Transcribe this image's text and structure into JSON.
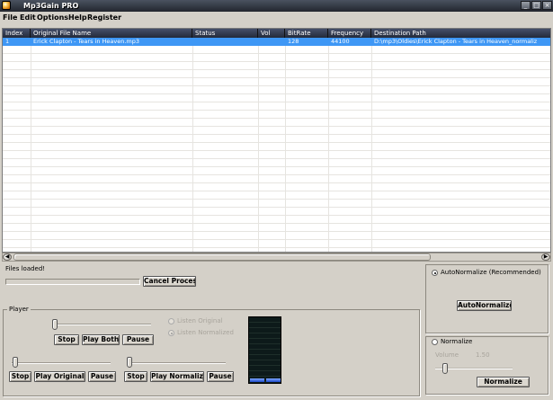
{
  "window": {
    "title": "Mp3Gain PRO"
  },
  "menu": [
    "File",
    "Edit",
    "Options",
    "Help",
    "Register"
  ],
  "table": {
    "columns": [
      "Index",
      "Original File Name",
      "Status",
      "Vol",
      "BitRate",
      "Frequency",
      "Destination Path"
    ],
    "rows": [
      [
        "1",
        "Erick Clapton - Tears in Heaven.mp3",
        "",
        "",
        "128",
        "44100",
        "D:\\mp3\\Oldies\\Erick Clapton - Tears in Heaven_normaliz"
      ]
    ]
  },
  "status": {
    "message": "Files loaded!",
    "progress": 0
  },
  "buttons": {
    "cancel": "Cancel Process",
    "auto_normalize": "AutoNormalize",
    "normalize": "Normalize"
  },
  "player": {
    "label": "Player",
    "stop": "Stop",
    "play_both": "Play Both",
    "pause": "Pause",
    "listen_original": "Listen Original",
    "listen_normalized": "Listen Normalized",
    "play_original": "Play Original",
    "play_normalize": "Play Normalize"
  },
  "options": {
    "auto_normalize_label": "AutoNormalize (Recommended)",
    "normalize_label": "Normalize",
    "volume_label": "Volume",
    "volume_value": "1.50"
  },
  "icons": [
    "app-icon",
    "minimize-icon",
    "maximize-icon",
    "close-icon",
    "scroll-left-icon",
    "scroll-right-icon"
  ]
}
